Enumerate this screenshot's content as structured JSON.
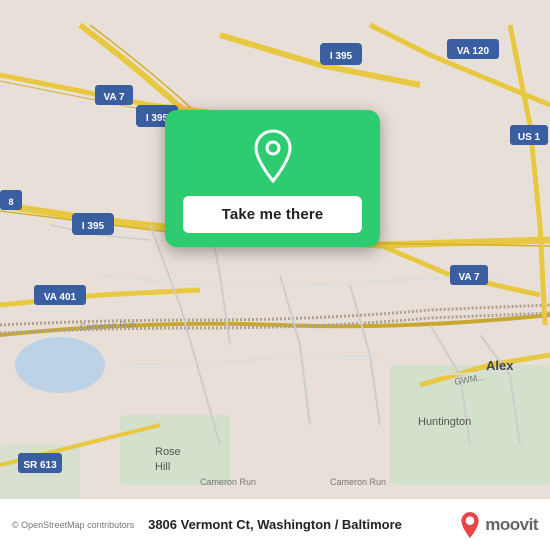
{
  "map": {
    "background_color": "#e8e0d8",
    "attribution": "© OpenStreetMap contributors"
  },
  "popup": {
    "button_label": "Take me there",
    "location_icon": "location-pin-icon"
  },
  "bottom_bar": {
    "osm_credit": "© OpenStreetMap contributors",
    "address": "3806 Vermont Ct, Washington / Baltimore",
    "moovit_label": "moovit"
  }
}
